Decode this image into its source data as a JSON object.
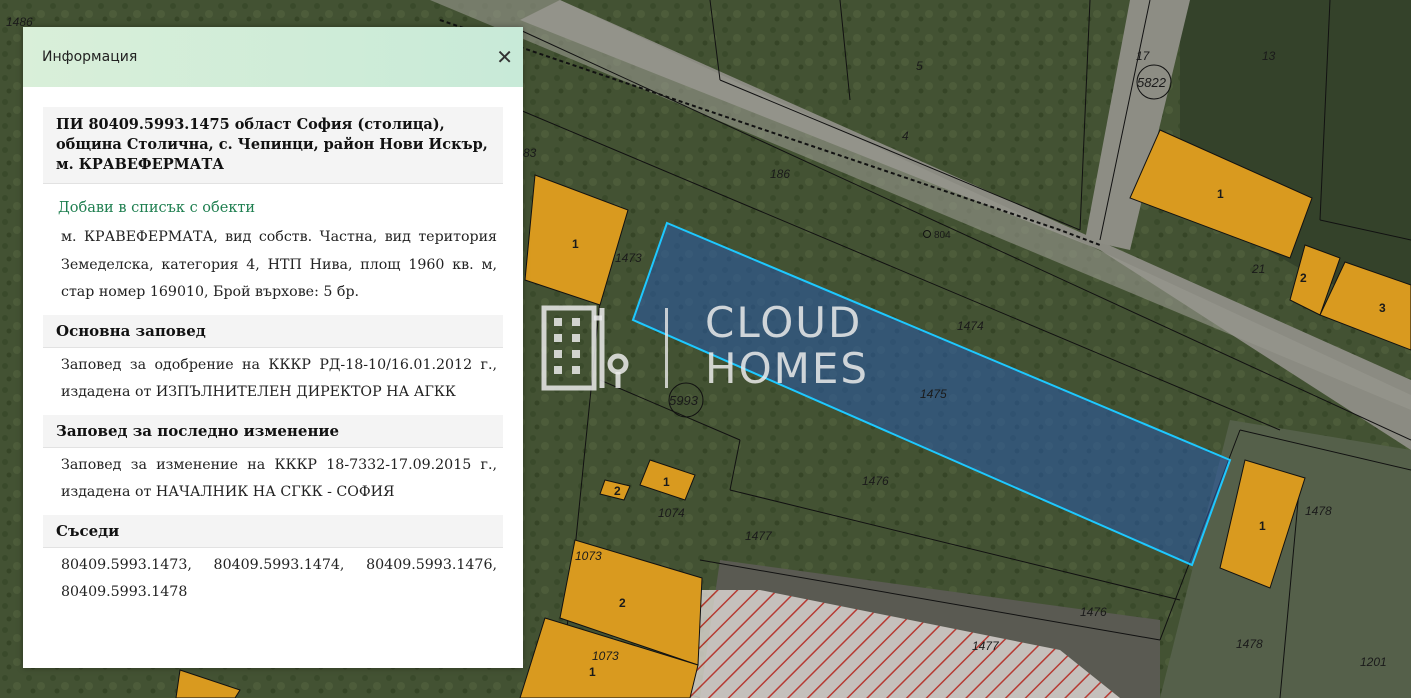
{
  "panel": {
    "title": "Информация",
    "close_icon": "close-icon",
    "property_heading": "ПИ 80409.5993.1475 област София (столица), община Столична, с. Чепинци, район Нови Искър, м. КРАВЕФЕРМАТА",
    "add_link": "Добави в списък с обекти",
    "details": "м. КРАВЕФЕРМАТА, вид собств. Частна, вид територия Земеделска, категория 4, НТП Нива, площ 1960 кв. м, стар номер 169010, Брой върхове: 5 бр.",
    "sections": [
      {
        "title": "Основна заповед",
        "text": "Заповед за одобрение на КККР РД-18-10/16.01.2012 г., издадена от ИЗПЪЛНИТЕЛЕН ДИРЕКТОР НА АГКК"
      },
      {
        "title": "Заповед за последно изменение",
        "text": "Заповед за изменение на КККР 18-7332-17.09.2015 г., издадена от НАЧАЛНИК НА СГКК - СОФИЯ"
      },
      {
        "title": "Съседи",
        "text": "80409.5993.1473, 80409.5993.1474, 80409.5993.1476, 80409.5993.1478"
      }
    ]
  },
  "watermark": {
    "line1": "CLOUD",
    "line2": "HOMES"
  },
  "map": {
    "selected_color": "#1ec8ff",
    "building_color": "#d99a1f",
    "parcel_labels": [
      "1486",
      "83",
      "5",
      "4",
      "13",
      "17",
      "186",
      "804",
      "1473",
      "1474",
      "1475",
      "1476",
      "1477",
      "1478",
      "1074",
      "1073",
      "21",
      "1201"
    ],
    "building_labels": [
      "1",
      "1",
      "1",
      "2",
      "3",
      "1",
      "2",
      "2",
      "1",
      "1"
    ],
    "cadastral_blocks": [
      "5822",
      "5993"
    ]
  }
}
